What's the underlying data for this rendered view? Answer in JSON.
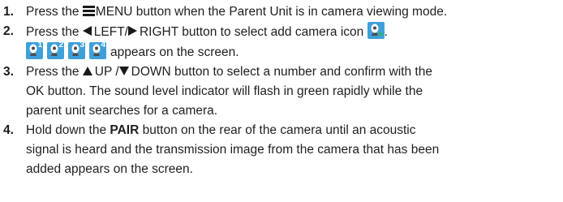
{
  "colors": {
    "text": "#1f1f1f",
    "camera_tile": "#3ea0da",
    "camera_body": "#ffffff",
    "camera_base": "#4c4c4c",
    "camera_plus": "#2db84a"
  },
  "icons": {
    "menu": "menu-icon",
    "left": "left-arrow-icon",
    "right": "right-arrow-icon",
    "up": "up-arrow-icon",
    "down": "down-arrow-icon",
    "add_camera": "add-camera-icon",
    "camera_slot": "camera-slot-icon"
  },
  "steps": [
    {
      "number": "1.",
      "pre": "Press the ",
      "menu_label": "MENU",
      "post": " button when the Parent Unit is in camera viewing mode."
    },
    {
      "number": "2.",
      "pre": "Press the ",
      "left_label": "LEFT/",
      "right_label": "RIGHT",
      "mid": " button to select add camera icon ",
      "end": ".",
      "camera_numbers": [
        "1",
        "2",
        "3",
        "4"
      ],
      "line2": "appears on the screen."
    },
    {
      "number": "3.",
      "pre": "Press the ",
      "up_label": "UP /",
      "down_label": "DOWN",
      "line1_end": " button to select a number and confirm with the",
      "line2": "OK button. The sound level indicator will flash in green rapidly while the",
      "line3": "parent unit searches for a camera."
    },
    {
      "number": "4.",
      "pre": "Hold down the ",
      "pair_label": "PAIR",
      "line1_end": " button on the rear of the camera until an acoustic",
      "line2": "signal is heard and the transmission image from the camera that has been",
      "line3": "added appears on the screen."
    }
  ]
}
